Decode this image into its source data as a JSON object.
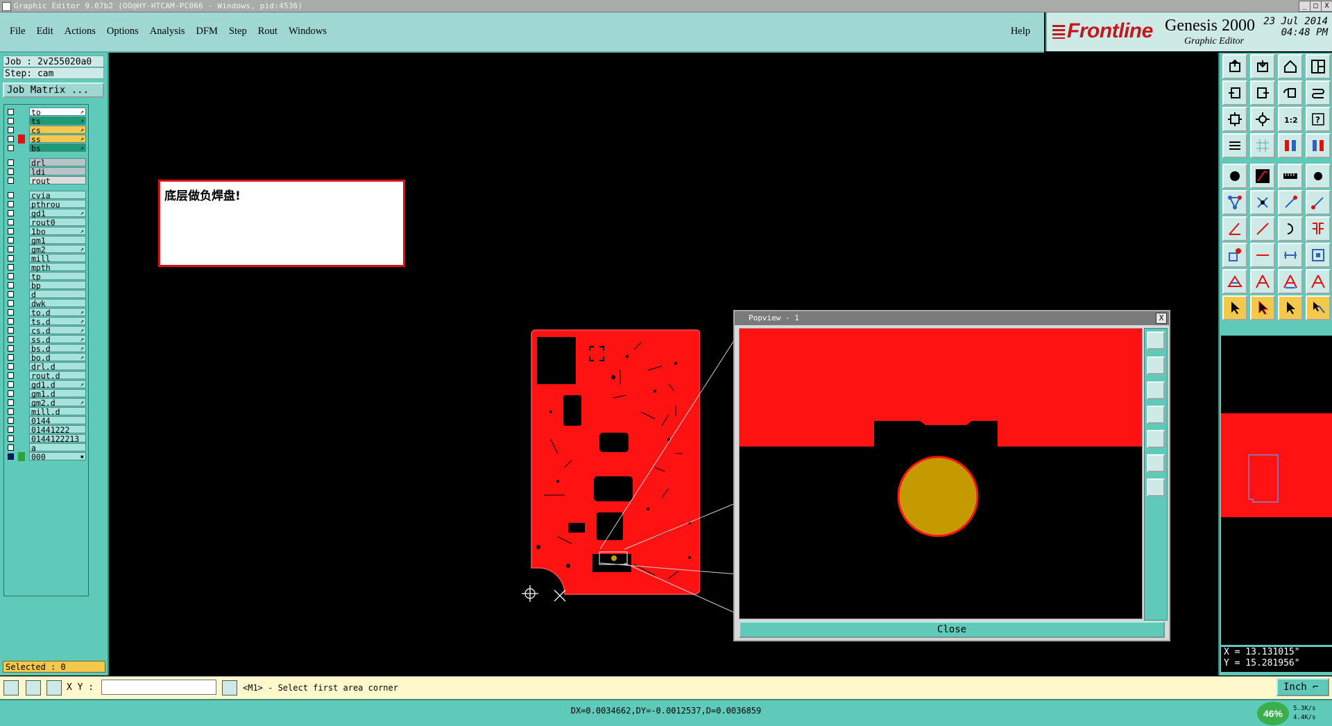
{
  "window": {
    "title": "Graphic Editor 9.07b2 (OO@HY-HTCAM-PC066 - Windows, pid:4536)",
    "min": "_",
    "max": "□",
    "close": "X"
  },
  "menu": {
    "items": [
      "File",
      "Edit",
      "Actions",
      "Options",
      "Analysis",
      "DFM",
      "Step",
      "Rout",
      "Windows"
    ],
    "help": "Help"
  },
  "brand": {
    "logo": "Frontline",
    "product": "Genesis 2000",
    "subtitle": "Graphic Editor",
    "date": "23 Jul 2014",
    "time": "04:48 PM"
  },
  "job": {
    "job_line": "Job : 2v255020a0",
    "step_line": "Step: cam",
    "matrix_button": "Job Matrix ..."
  },
  "layers": [
    {
      "name": "to",
      "bg": "#ffffff",
      "arrow": true
    },
    {
      "name": "ts",
      "bg": "#1f9a76",
      "arrow": true
    },
    {
      "name": "cs",
      "bg": "#f4c84a",
      "arrow": true
    },
    {
      "name": "ss",
      "bg": "#f4c84a",
      "arrow": true,
      "mark": "#e01010"
    },
    {
      "name": "bs",
      "bg": "#1f9a76",
      "arrow": true
    },
    {
      "name": "drl",
      "bg": "#b8c4c8",
      "arrow": false
    },
    {
      "name": "ldi",
      "bg": "#b8c4c8",
      "arrow": false
    },
    {
      "name": "rout",
      "bg": "#dcdcdc",
      "arrow": false
    },
    {
      "name": "cvia",
      "bg": "#a6e3dc",
      "arrow": false
    },
    {
      "name": "pthrou",
      "bg": "#a6e3dc",
      "arrow": false
    },
    {
      "name": "gd1",
      "bg": "#a6e3dc",
      "arrow": true
    },
    {
      "name": "rout0",
      "bg": "#a6e3dc",
      "arrow": false
    },
    {
      "name": "1bo",
      "bg": "#a6e3dc",
      "arrow": true
    },
    {
      "name": "gm1",
      "bg": "#a6e3dc",
      "arrow": false
    },
    {
      "name": "gm2",
      "bg": "#a6e3dc",
      "arrow": true
    },
    {
      "name": "mill",
      "bg": "#a6e3dc",
      "arrow": false
    },
    {
      "name": "mpth",
      "bg": "#a6e3dc",
      "arrow": false
    },
    {
      "name": "tp",
      "bg": "#a6e3dc",
      "arrow": false
    },
    {
      "name": "bp",
      "bg": "#a6e3dc",
      "arrow": false
    },
    {
      "name": "d",
      "bg": "#a6e3dc",
      "arrow": false
    },
    {
      "name": "dwk",
      "bg": "#a6e3dc",
      "arrow": false
    },
    {
      "name": "to.d",
      "bg": "#a6e3dc",
      "arrow": true
    },
    {
      "name": "ts.d",
      "bg": "#a6e3dc",
      "arrow": true
    },
    {
      "name": "cs.d",
      "bg": "#a6e3dc",
      "arrow": true
    },
    {
      "name": "ss.d",
      "bg": "#a6e3dc",
      "arrow": true
    },
    {
      "name": "bs.d",
      "bg": "#a6e3dc",
      "arrow": true
    },
    {
      "name": "bo.d",
      "bg": "#a6e3dc",
      "arrow": true
    },
    {
      "name": "drl.d",
      "bg": "#a6e3dc",
      "arrow": false
    },
    {
      "name": "rout.d",
      "bg": "#a6e3dc",
      "arrow": false
    },
    {
      "name": "gd1.d",
      "bg": "#a6e3dc",
      "arrow": true
    },
    {
      "name": "gm1.d",
      "bg": "#a6e3dc",
      "arrow": false
    },
    {
      "name": "gm2.d",
      "bg": "#a6e3dc",
      "arrow": true
    },
    {
      "name": "mill.d",
      "bg": "#a6e3dc",
      "arrow": false
    },
    {
      "name": "0144",
      "bg": "#a6e3dc",
      "arrow": false
    },
    {
      "name": "01441222",
      "bg": "#a6e3dc",
      "arrow": false
    },
    {
      "name": "0144122213",
      "bg": "#a6e3dc",
      "arrow": false
    },
    {
      "name": "a",
      "bg": "#a6e3dc",
      "arrow": false
    },
    {
      "name": "000",
      "bg": "#a6e3dc",
      "arrow": false,
      "mark": "#2aa63a",
      "dot": true,
      "last": true
    }
  ],
  "selected": "Selected : 0",
  "note": "底层做负焊盘!",
  "popview": {
    "title": "Popview - 1",
    "close_label": "Close",
    "close_x": "X"
  },
  "coords": {
    "x": "X = 13.131015\"",
    "y": "Y = 15.281956\""
  },
  "cmd": {
    "xy_label": "X Y :",
    "xy_value": "",
    "prompt": "<M1> - Select first area corner",
    "unit": "Inch ⌐"
  },
  "status": {
    "text": "DX=0.0034662,DY=-0.0012537,D=0.0036859",
    "net_percent": "46%",
    "up": "5.3K/s",
    "down": "4.4K/s"
  },
  "colors": {
    "copper": "#ff0000",
    "pad": "#c59a00",
    "panel": "#5fc9ba",
    "menubar": "#9fd7d2"
  }
}
